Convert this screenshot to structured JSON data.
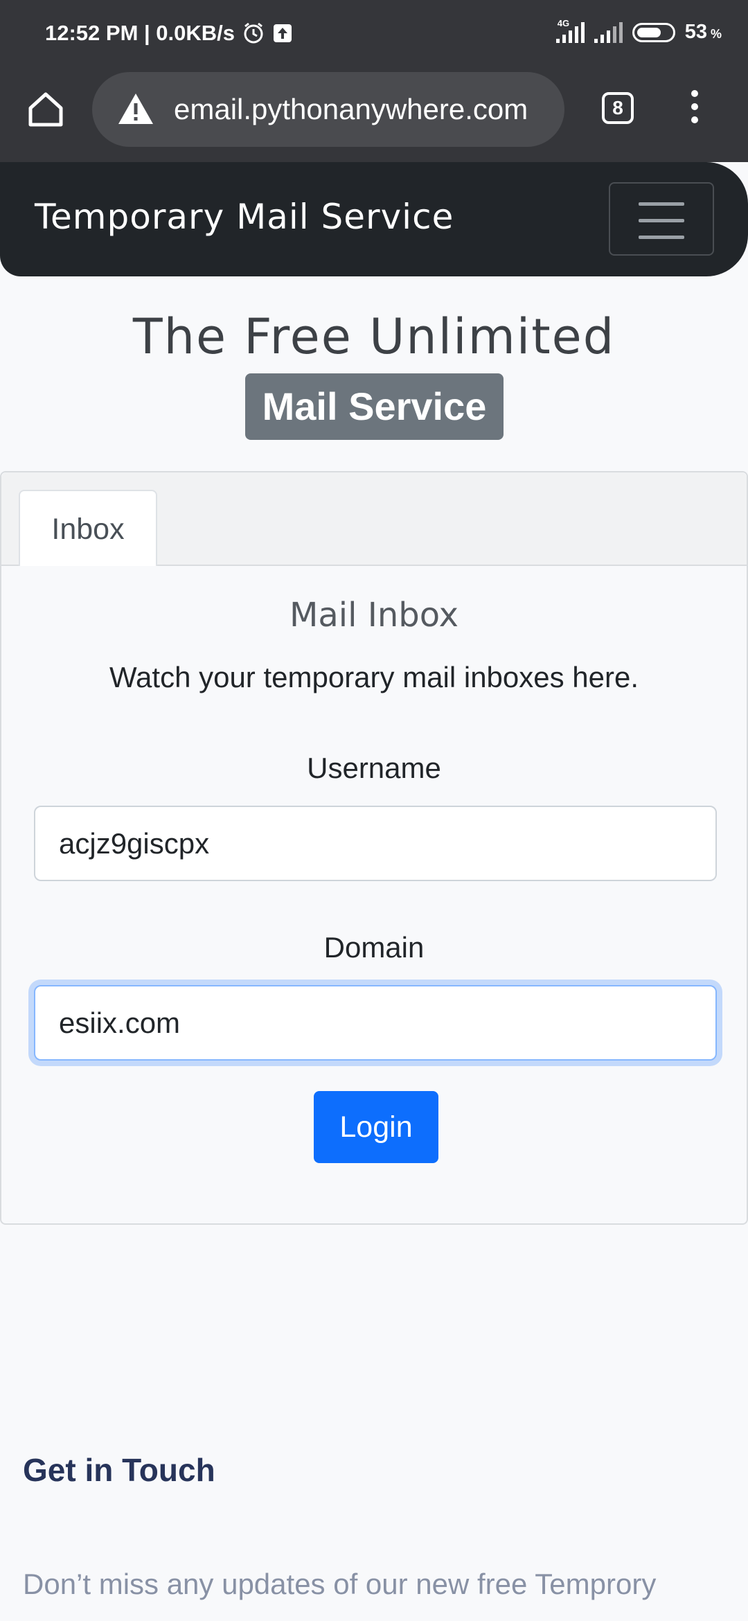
{
  "status_bar": {
    "time_speed": "12:52 PM | 0.0KB/s",
    "network": "4G",
    "battery": "53"
  },
  "browser": {
    "url": "email.pythonanywhere.com",
    "tab_count": "8"
  },
  "navbar": {
    "brand": "Temporary Mail Service"
  },
  "hero": {
    "title": "The Free Unlimited",
    "badge": "Mail Service"
  },
  "card": {
    "tab_label": "Inbox",
    "title": "Mail Inbox",
    "text": "Watch your temporary mail inboxes here.",
    "username_label": "Username",
    "username_value": "acjz9giscpx",
    "domain_label": "Domain",
    "domain_value": "esiix.com",
    "login_label": "Login"
  },
  "footer": {
    "title": "Get in Touch",
    "text": "Don’t miss any updates of our new free Temprory"
  }
}
